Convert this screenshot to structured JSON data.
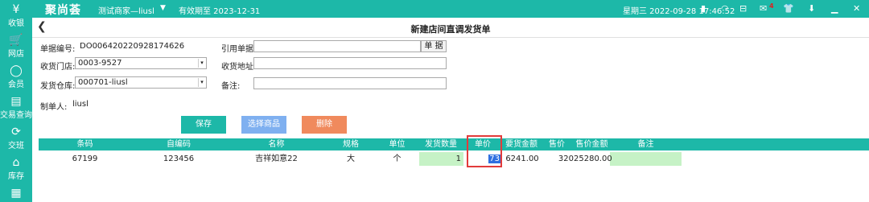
{
  "topbar": {
    "logo": "聚尚荟",
    "merchant": "测试商家—liusl",
    "expiry": "有效期至 2023-12-31",
    "datetime": "星期三 2022-09-28 17:46:52",
    "badge": "4"
  },
  "sidebar": {
    "items": [
      {
        "label": "收银",
        "icon": "yen-icon"
      },
      {
        "label": "网店",
        "icon": "cart-icon"
      },
      {
        "label": "会员",
        "icon": "person-icon"
      },
      {
        "label": "交易查询",
        "icon": "document-icon"
      },
      {
        "label": "交班",
        "icon": "handover-icon"
      },
      {
        "label": "库存",
        "icon": "house-icon"
      }
    ]
  },
  "page": {
    "title": "新建店间直调发货单"
  },
  "form": {
    "doc_no_label": "单据编号:",
    "doc_no_value": "DO006420220928174626",
    "ref_doc_label": "引用单据:",
    "ref_doc_button": "单 据",
    "recv_store_label": "收货门店:",
    "recv_store_value": "0003-9527",
    "recv_addr_label": "收货地址:",
    "warehouse_label": "发货仓库:",
    "warehouse_value": "000701-liusl",
    "remark_label": "备注:",
    "creator_label": "制单人:",
    "creator_value": "liusl"
  },
  "actions": {
    "save": "保存",
    "select_goods": "选择商品",
    "delete": "删除"
  },
  "table": {
    "headers": [
      "条码",
      "自编码",
      "名称",
      "规格",
      "单位",
      "发货数量",
      "单价",
      "要货金额",
      "售价",
      "售价金额",
      "备注"
    ],
    "rows": [
      {
        "barcode": "67199",
        "code": "123456",
        "name": "吉祥如意22",
        "spec": "大",
        "unit": "个",
        "qty": "1",
        "price": "73",
        "amount": "6241.00",
        "sale_price": "320",
        "sale_amount": "25280.00",
        "remark": ""
      }
    ]
  },
  "colors": {
    "accent": "#1db8a8",
    "save": "#1db8a8",
    "select": "#7fb0f0",
    "delete": "#f08a5d",
    "highlight": "#e23b3b"
  }
}
